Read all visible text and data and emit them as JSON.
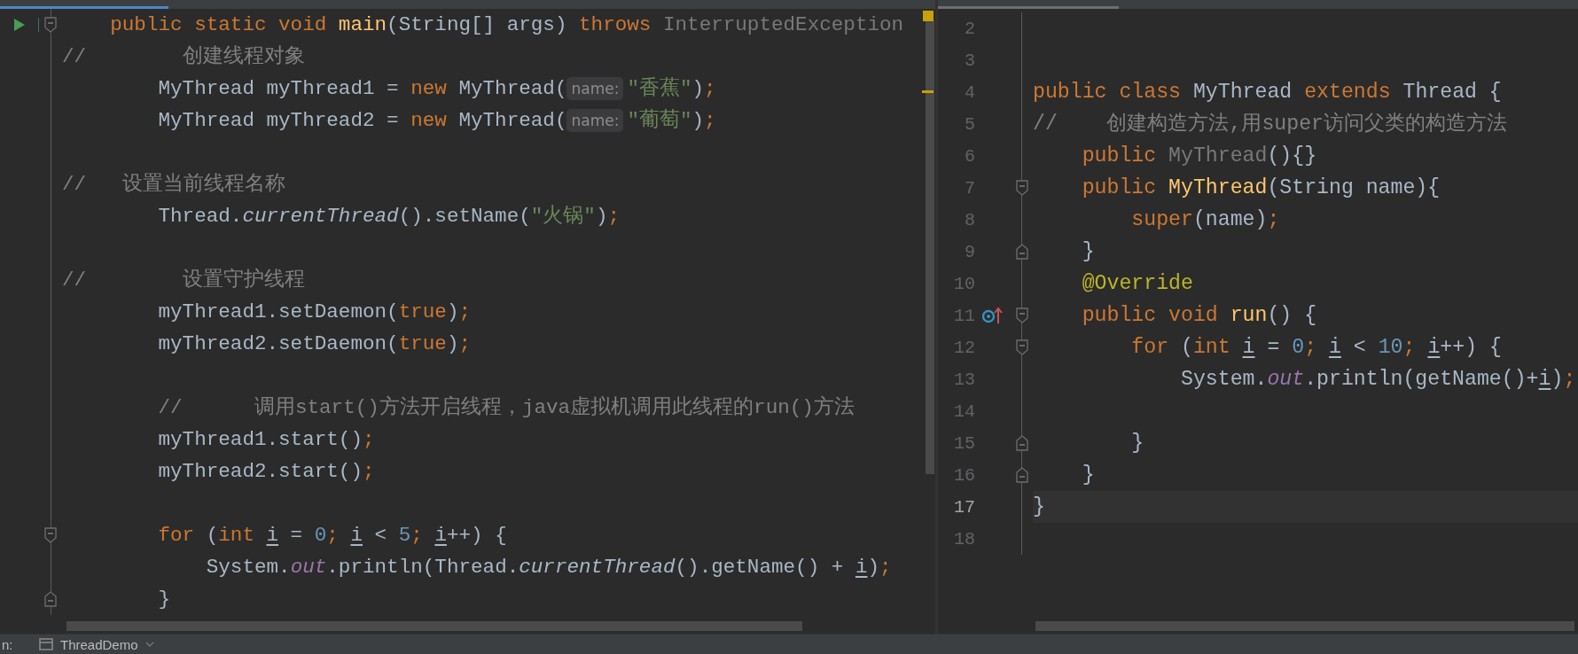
{
  "left_editor": {
    "lines": [
      {
        "gutter": [
          {
            "kind": "run"
          },
          {
            "kind": "fold_start"
          }
        ],
        "tokens": [
          {
            "kind": "kw",
            "text": "    public static void "
          },
          {
            "kind": "decl",
            "text": "main"
          },
          {
            "kind": "plain",
            "text": "(String[] args) "
          },
          {
            "kind": "kw",
            "text": "throws "
          },
          {
            "kind": "dim",
            "text": "InterruptedException"
          }
        ]
      },
      {
        "tokens": [
          {
            "kind": "comment",
            "text": "//        创建线程对象"
          }
        ]
      },
      {
        "tokens": [
          {
            "kind": "plain",
            "text": "        MyThread myThread1 = "
          },
          {
            "kind": "kw",
            "text": "new "
          },
          {
            "kind": "plain",
            "text": "MyThread("
          },
          {
            "kind": "hint",
            "text": "name:"
          },
          {
            "kind": "str",
            "text": "\"香蕉\""
          },
          {
            "kind": "plain",
            "text": ")"
          },
          {
            "kind": "kw",
            "text": ";"
          }
        ]
      },
      {
        "tokens": [
          {
            "kind": "plain",
            "text": "        MyThread myThread2 = "
          },
          {
            "kind": "kw",
            "text": "new "
          },
          {
            "kind": "plain",
            "text": "MyThread("
          },
          {
            "kind": "hint",
            "text": "name:"
          },
          {
            "kind": "str",
            "text": "\"葡萄\""
          },
          {
            "kind": "plain",
            "text": ")"
          },
          {
            "kind": "kw",
            "text": ";"
          }
        ]
      },
      {
        "blank_before": true,
        "tokens": [
          {
            "kind": "comment",
            "text": "//   设置当前线程名称"
          }
        ]
      },
      {
        "tokens": [
          {
            "kind": "plain",
            "text": "        Thread."
          },
          {
            "kind": "italic",
            "text": "currentThread"
          },
          {
            "kind": "plain",
            "text": "().setName("
          },
          {
            "kind": "str",
            "text": "\"火锅\""
          },
          {
            "kind": "plain",
            "text": ")"
          },
          {
            "kind": "kw",
            "text": ";"
          }
        ]
      },
      {
        "blank_before": true,
        "tokens": [
          {
            "kind": "comment",
            "text": "//        设置守护线程"
          }
        ]
      },
      {
        "tokens": [
          {
            "kind": "plain",
            "text": "        myThread1.setDaemon("
          },
          {
            "kind": "kw",
            "text": "true"
          },
          {
            "kind": "plain",
            "text": ")"
          },
          {
            "kind": "kw",
            "text": ";"
          }
        ]
      },
      {
        "tokens": [
          {
            "kind": "plain",
            "text": "        myThread2.setDaemon("
          },
          {
            "kind": "kw",
            "text": "true"
          },
          {
            "kind": "plain",
            "text": ")"
          },
          {
            "kind": "kw",
            "text": ";"
          }
        ]
      },
      {
        "blank_before": true,
        "tokens": [
          {
            "kind": "comment",
            "text": "        //      调用start()方法开启线程，java虚拟机调用此线程的run()方法"
          }
        ]
      },
      {
        "tokens": [
          {
            "kind": "plain",
            "text": "        myThread1.start()"
          },
          {
            "kind": "kw",
            "text": ";"
          }
        ]
      },
      {
        "tokens": [
          {
            "kind": "plain",
            "text": "        myThread2.start()"
          },
          {
            "kind": "kw",
            "text": ";"
          }
        ]
      },
      {
        "blank_before": true,
        "gutter": [
          {
            "kind": "fold_start"
          }
        ],
        "tokens": [
          {
            "kind": "kw",
            "text": "        for "
          },
          {
            "kind": "plain",
            "text": "("
          },
          {
            "kind": "kw",
            "text": "int "
          },
          {
            "kind": "var",
            "text": "i"
          },
          {
            "kind": "plain",
            "text": " = "
          },
          {
            "kind": "num",
            "text": "0"
          },
          {
            "kind": "kw",
            "text": "; "
          },
          {
            "kind": "var",
            "text": "i"
          },
          {
            "kind": "plain",
            "text": " < "
          },
          {
            "kind": "num",
            "text": "5"
          },
          {
            "kind": "kw",
            "text": "; "
          },
          {
            "kind": "var",
            "text": "i"
          },
          {
            "kind": "plain",
            "text": "++) {"
          }
        ]
      },
      {
        "tokens": [
          {
            "kind": "plain",
            "text": "            System."
          },
          {
            "kind": "field",
            "text": "out"
          },
          {
            "kind": "plain",
            "text": ".println(Thread."
          },
          {
            "kind": "italic",
            "text": "currentThread"
          },
          {
            "kind": "plain",
            "text": "().getName() + "
          },
          {
            "kind": "var",
            "text": "i"
          },
          {
            "kind": "plain",
            "text": ")"
          },
          {
            "kind": "kw",
            "text": ";"
          }
        ]
      },
      {
        "gutter": [
          {
            "kind": "fold_end"
          }
        ],
        "tokens": [
          {
            "kind": "plain",
            "text": "        }"
          }
        ]
      }
    ]
  },
  "right_editor": {
    "lines": [
      {
        "number": "2",
        "current": false
      },
      {
        "number": "3",
        "current": false
      },
      {
        "number": "4",
        "current": false,
        "tokens": [
          {
            "kind": "kw",
            "text": "public class "
          },
          {
            "kind": "plain",
            "text": "MyThread "
          },
          {
            "kind": "kw",
            "text": "extends "
          },
          {
            "kind": "plain",
            "text": "Thread {"
          }
        ]
      },
      {
        "number": "5",
        "current": false,
        "tokens": [
          {
            "kind": "comment",
            "text": "//    创建构造方法,用super访问父类的构造方法"
          }
        ]
      },
      {
        "number": "6",
        "current": false,
        "tokens": [
          {
            "kind": "kw",
            "text": "    public "
          },
          {
            "kind": "dim",
            "text": "MyThread"
          },
          {
            "kind": "plain",
            "text": "(){}"
          }
        ]
      },
      {
        "number": "7",
        "current": false,
        "gutter": [
          {
            "kind": "fold_start"
          }
        ],
        "tokens": [
          {
            "kind": "kw",
            "text": "    public "
          },
          {
            "kind": "decl",
            "text": "MyThread"
          },
          {
            "kind": "plain",
            "text": "(String name){"
          }
        ]
      },
      {
        "number": "8",
        "current": false,
        "tokens": [
          {
            "kind": "kw",
            "text": "        super"
          },
          {
            "kind": "plain",
            "text": "(name)"
          },
          {
            "kind": "kw",
            "text": ";"
          }
        ]
      },
      {
        "number": "9",
        "current": false,
        "gutter": [
          {
            "kind": "fold_end"
          }
        ],
        "tokens": [
          {
            "kind": "plain",
            "text": "    }"
          }
        ]
      },
      {
        "number": "10",
        "current": false,
        "tokens": [
          {
            "kind": "annot",
            "text": "    @Override"
          }
        ]
      },
      {
        "number": "11",
        "current": false,
        "gutter": [
          {
            "kind": "override"
          },
          {
            "kind": "fold_start"
          }
        ],
        "tokens": [
          {
            "kind": "kw",
            "text": "    public void "
          },
          {
            "kind": "decl",
            "text": "run"
          },
          {
            "kind": "plain",
            "text": "() {"
          }
        ]
      },
      {
        "number": "12",
        "current": false,
        "gutter": [
          {
            "kind": "fold_start"
          }
        ],
        "tokens": [
          {
            "kind": "kw",
            "text": "        for "
          },
          {
            "kind": "plain",
            "text": "("
          },
          {
            "kind": "kw",
            "text": "int "
          },
          {
            "kind": "var",
            "text": "i"
          },
          {
            "kind": "plain",
            "text": " = "
          },
          {
            "kind": "num",
            "text": "0"
          },
          {
            "kind": "kw",
            "text": "; "
          },
          {
            "kind": "var",
            "text": "i"
          },
          {
            "kind": "plain",
            "text": " < "
          },
          {
            "kind": "num",
            "text": "10"
          },
          {
            "kind": "kw",
            "text": "; "
          },
          {
            "kind": "var",
            "text": "i"
          },
          {
            "kind": "plain",
            "text": "++) {"
          }
        ]
      },
      {
        "number": "13",
        "current": false,
        "tokens": [
          {
            "kind": "plain",
            "text": "            System."
          },
          {
            "kind": "field",
            "text": "out"
          },
          {
            "kind": "plain",
            "text": ".println(getName()+"
          },
          {
            "kind": "var",
            "text": "i"
          },
          {
            "kind": "plain",
            "text": ")"
          },
          {
            "kind": "kw",
            "text": ";"
          }
        ]
      },
      {
        "number": "14",
        "current": false
      },
      {
        "number": "15",
        "current": false,
        "gutter": [
          {
            "kind": "fold_end"
          }
        ],
        "tokens": [
          {
            "kind": "plain",
            "text": "        }"
          }
        ]
      },
      {
        "number": "16",
        "current": false,
        "gutter": [
          {
            "kind": "fold_end"
          }
        ],
        "tokens": [
          {
            "kind": "plain",
            "text": "    }"
          }
        ]
      },
      {
        "number": "17",
        "current": true,
        "tokens": [
          {
            "kind": "plain",
            "text": "}"
          }
        ]
      },
      {
        "number": "18",
        "current": false
      }
    ]
  },
  "run_bar": {
    "label": "n:",
    "configuration": "ThreadDemo"
  }
}
